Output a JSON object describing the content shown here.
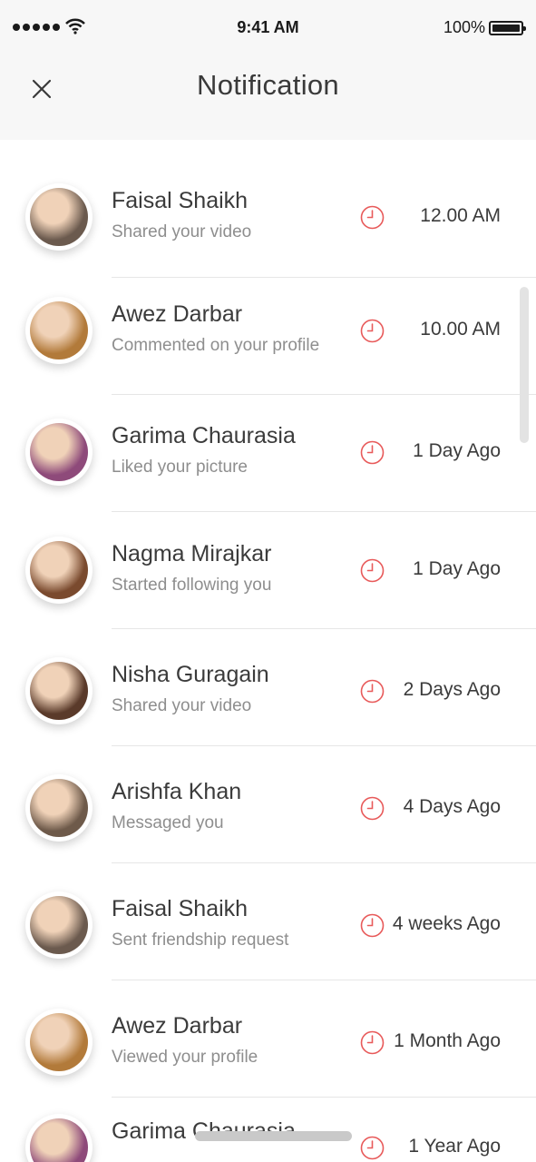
{
  "status_bar": {
    "time": "9:41 AM",
    "battery": "100%"
  },
  "header": {
    "title": "Notification"
  },
  "colors": {
    "accent": "#e85a5a",
    "header_bg": "#f7f7f7",
    "divider": "#e6e6e6"
  },
  "notifications": [
    {
      "name": "Faisal Shaikh",
      "action": "Shared your video",
      "time": "12.00 AM",
      "avatar_color": "#6b5a4e"
    },
    {
      "name": "Awez Darbar",
      "action": "Commented on your profile",
      "time": "10.00 AM",
      "avatar_color": "#b27a3a"
    },
    {
      "name": "Garima Chaurasia",
      "action": "Liked your picture",
      "time": "1 Day Ago",
      "avatar_color": "#8e4a7a"
    },
    {
      "name": "Nagma Mirajkar",
      "action": "Started following you",
      "time": "1 Day Ago",
      "avatar_color": "#7a4a2e"
    },
    {
      "name": "Nisha Guragain",
      "action": "Shared your video",
      "time": "2 Days Ago",
      "avatar_color": "#5a3a2a"
    },
    {
      "name": "Arishfa Khan",
      "action": "Messaged you",
      "time": "4 Days Ago",
      "avatar_color": "#6e5a4a"
    },
    {
      "name": "Faisal Shaikh",
      "action": "Sent friendship request",
      "time": "4 weeks Ago",
      "avatar_color": "#6b5a4e"
    },
    {
      "name": "Awez Darbar",
      "action": "Viewed your profile",
      "time": "1 Month Ago",
      "avatar_color": "#b27a3a"
    },
    {
      "name": "Garima Chaurasia",
      "action": "",
      "time": "1 Year Ago",
      "avatar_color": "#8e4a7a"
    }
  ]
}
